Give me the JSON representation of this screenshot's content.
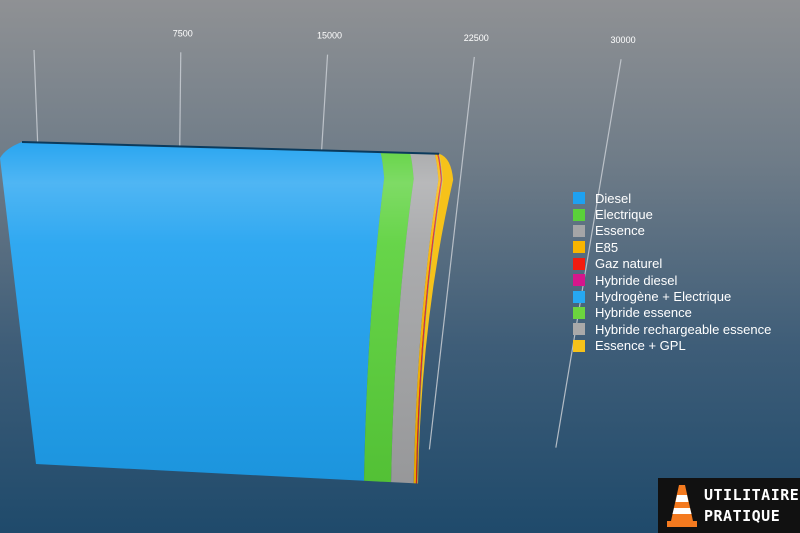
{
  "chart_data": {
    "type": "bar",
    "orientation": "horizontal",
    "stacked": true,
    "title": "",
    "xlabel": "",
    "ylabel": "",
    "xlim": [
      0,
      32500
    ],
    "x_ticks": [
      7500,
      15000,
      22500,
      30000
    ],
    "grid": true,
    "legend_position": "right",
    "series": [
      {
        "name": "Diesel",
        "color": "#1ea1f0",
        "values": [
          21800
        ]
      },
      {
        "name": "Electrique",
        "color": "#5ad13a",
        "values": [
          1800
        ]
      },
      {
        "name": "Essence",
        "color": "#a4a5a7",
        "values": [
          1500
        ]
      },
      {
        "name": "E85",
        "color": "#f8b500",
        "values": [
          150
        ]
      },
      {
        "name": "Gaz naturel",
        "color": "#f21c0f",
        "values": [
          60
        ]
      },
      {
        "name": "Hybride diesel",
        "color": "#d5168c",
        "values": [
          15
        ]
      },
      {
        "name": "Hydrogène + Electrique",
        "color": "#26a8f2",
        "values": [
          5
        ]
      },
      {
        "name": "Hybride essence",
        "color": "#6cd43e",
        "values": [
          10
        ]
      },
      {
        "name": "Hybride rechargeable essence",
        "color": "#a9a9a9",
        "values": [
          10
        ]
      },
      {
        "name": "Essence + GPL",
        "color": "#f6c21a",
        "values": [
          40
        ]
      }
    ]
  },
  "logo": {
    "line1": "UTILITAIRE",
    "line2": "PRATIQUE",
    "cone_color": "#f47a1f"
  }
}
